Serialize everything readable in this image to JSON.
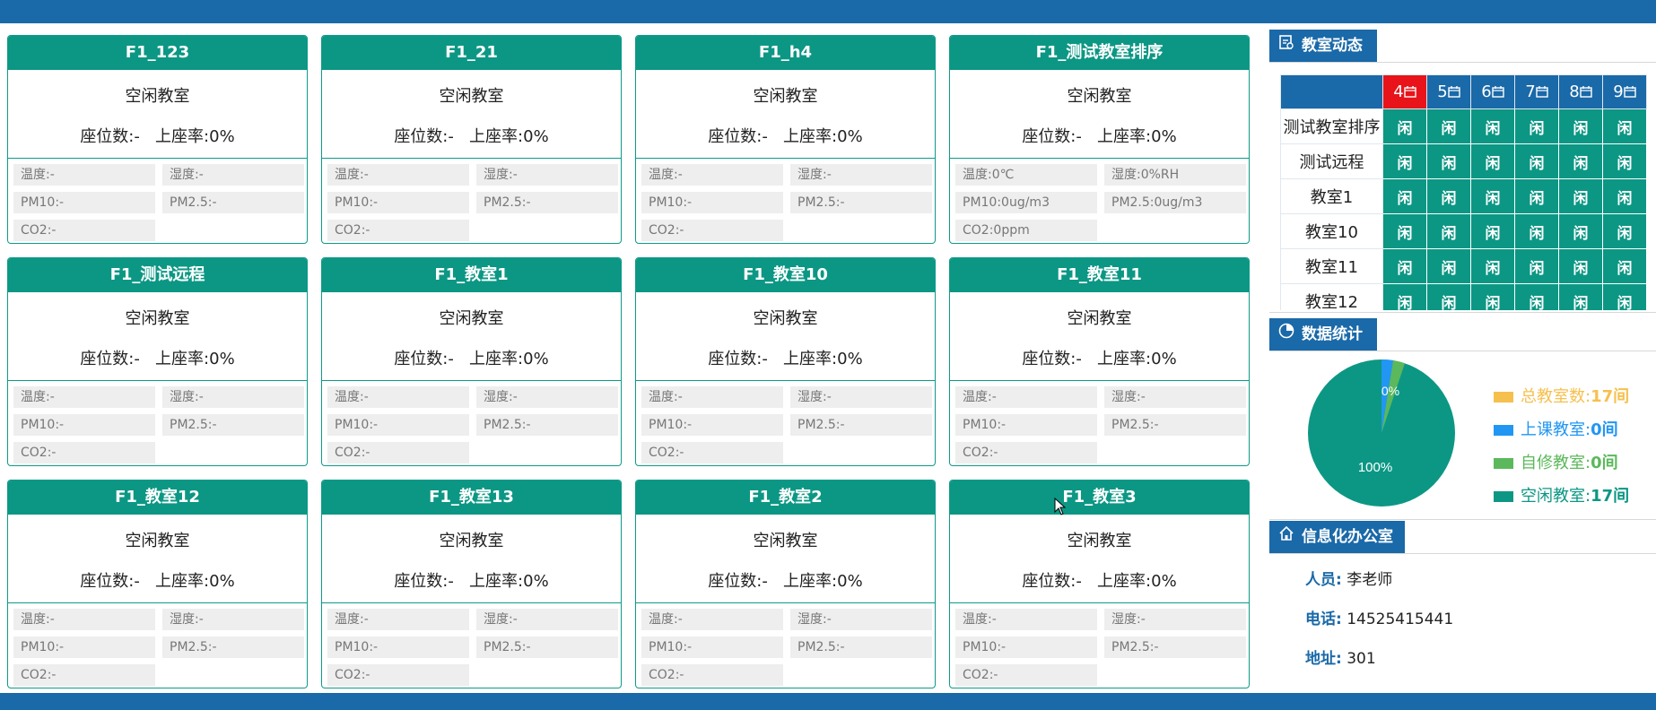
{
  "rooms": [
    {
      "title": "F1_123",
      "status": "空闲教室",
      "seat_label": "座位数:-",
      "rate_label": "上座率:",
      "rate": "0%",
      "temp": "温度:-",
      "humidity": "湿度:-",
      "pm10": "PM10:-",
      "pm25": "PM2.5:-",
      "co2": "CO2:-"
    },
    {
      "title": "F1_21",
      "status": "空闲教室",
      "seat_label": "座位数:-",
      "rate_label": "上座率:",
      "rate": "0%",
      "temp": "温度:-",
      "humidity": "湿度:-",
      "pm10": "PM10:-",
      "pm25": "PM2.5:-",
      "co2": "CO2:-"
    },
    {
      "title": "F1_h4",
      "status": "空闲教室",
      "seat_label": "座位数:-",
      "rate_label": "上座率:",
      "rate": "0%",
      "temp": "温度:-",
      "humidity": "湿度:-",
      "pm10": "PM10:-",
      "pm25": "PM2.5:-",
      "co2": "CO2:-"
    },
    {
      "title": "F1_测试教室排序",
      "status": "空闲教室",
      "seat_label": "座位数:-",
      "rate_label": "上座率:",
      "rate": "0%",
      "temp": "温度:0℃",
      "humidity": "湿度:0%RH",
      "pm10": "PM10:0ug/m3",
      "pm25": "PM2.5:0ug/m3",
      "co2": "CO2:0ppm"
    },
    {
      "title": "F1_测试远程",
      "status": "空闲教室",
      "seat_label": "座位数:-",
      "rate_label": "上座率:",
      "rate": "0%",
      "temp": "温度:-",
      "humidity": "湿度:-",
      "pm10": "PM10:-",
      "pm25": "PM2.5:-",
      "co2": "CO2:-"
    },
    {
      "title": "F1_教室1",
      "status": "空闲教室",
      "seat_label": "座位数:-",
      "rate_label": "上座率:",
      "rate": "0%",
      "temp": "温度:-",
      "humidity": "湿度:-",
      "pm10": "PM10:-",
      "pm25": "PM2.5:-",
      "co2": "CO2:-"
    },
    {
      "title": "F1_教室10",
      "status": "空闲教室",
      "seat_label": "座位数:-",
      "rate_label": "上座率:",
      "rate": "0%",
      "temp": "温度:-",
      "humidity": "湿度:-",
      "pm10": "PM10:-",
      "pm25": "PM2.5:-",
      "co2": "CO2:-"
    },
    {
      "title": "F1_教室11",
      "status": "空闲教室",
      "seat_label": "座位数:-",
      "rate_label": "上座率:",
      "rate": "0%",
      "temp": "温度:-",
      "humidity": "湿度:-",
      "pm10": "PM10:-",
      "pm25": "PM2.5:-",
      "co2": "CO2:-"
    },
    {
      "title": "F1_教室12",
      "status": "空闲教室",
      "seat_label": "座位数:-",
      "rate_label": "上座率:",
      "rate": "0%",
      "temp": "温度:-",
      "humidity": "湿度:-",
      "pm10": "PM10:-",
      "pm25": "PM2.5:-",
      "co2": "CO2:-"
    },
    {
      "title": "F1_教室13",
      "status": "空闲教室",
      "seat_label": "座位数:-",
      "rate_label": "上座率:",
      "rate": "0%",
      "temp": "温度:-",
      "humidity": "湿度:-",
      "pm10": "PM10:-",
      "pm25": "PM2.5:-",
      "co2": "CO2:-"
    },
    {
      "title": "F1_教室2",
      "status": "空闲教室",
      "seat_label": "座位数:-",
      "rate_label": "上座率:",
      "rate": "0%",
      "temp": "温度:-",
      "humidity": "湿度:-",
      "pm10": "PM10:-",
      "pm25": "PM2.5:-",
      "co2": "CO2:-"
    },
    {
      "title": "F1_教室3",
      "status": "空闲教室",
      "seat_label": "座位数:-",
      "rate_label": "上座率:",
      "rate": "0%",
      "temp": "温度:-",
      "humidity": "湿度:-",
      "pm10": "PM10:-",
      "pm25": "PM2.5:-",
      "co2": "CO2:-"
    }
  ],
  "dynamics": {
    "title": "教室动态",
    "icon": "schedule-icon",
    "periods": [
      "4",
      "5",
      "6",
      "7",
      "8",
      "9"
    ],
    "active_period": "4",
    "rows": [
      {
        "name": "测试教室排序",
        "cells": [
          "闲",
          "闲",
          "闲",
          "闲",
          "闲",
          "闲"
        ]
      },
      {
        "name": "测试远程",
        "cells": [
          "闲",
          "闲",
          "闲",
          "闲",
          "闲",
          "闲"
        ]
      },
      {
        "name": "教室1",
        "cells": [
          "闲",
          "闲",
          "闲",
          "闲",
          "闲",
          "闲"
        ]
      },
      {
        "name": "教室10",
        "cells": [
          "闲",
          "闲",
          "闲",
          "闲",
          "闲",
          "闲"
        ]
      },
      {
        "name": "教室11",
        "cells": [
          "闲",
          "闲",
          "闲",
          "闲",
          "闲",
          "闲"
        ]
      },
      {
        "name": "教室12",
        "cells": [
          "闲",
          "闲",
          "闲",
          "闲",
          "闲",
          "闲"
        ]
      }
    ]
  },
  "stats": {
    "title": "数据统计",
    "icon": "pie-chart-icon",
    "pie_label_small": "0%",
    "pie_label_large": "100%",
    "legend": [
      {
        "label": "总教室数:",
        "value": "17间",
        "color": "#f6c04f"
      },
      {
        "label": "上课教室:",
        "value": "0间",
        "color": "#2196f3"
      },
      {
        "label": "自修教室:",
        "value": "0间",
        "color": "#5cb85c"
      },
      {
        "label": "空闲教室:",
        "value": "17间",
        "color": "#0c9784"
      }
    ]
  },
  "office": {
    "title": "信息化办公室",
    "icon": "home-icon",
    "person_label": "人员:",
    "person": "李老师",
    "phone_label": "电话:",
    "phone": "14525415441",
    "address_label": "地址:",
    "address": "301"
  },
  "colors": {
    "header": "#1a69a8",
    "card_head": "#0c9784",
    "active_period": "#e8141a"
  }
}
